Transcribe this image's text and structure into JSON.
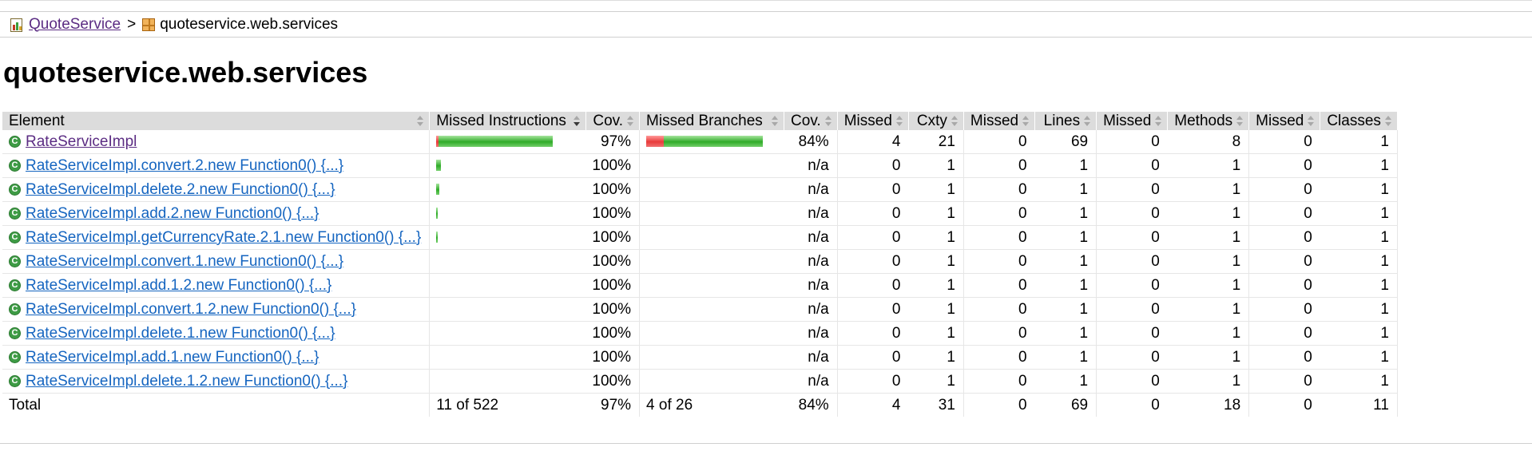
{
  "breadcrumb": {
    "root": "QuoteService",
    "separator": ">",
    "current": "quoteservice.web.services"
  },
  "page_title": "quoteservice.web.services",
  "table": {
    "headers": [
      "Element",
      "Missed Instructions",
      "Cov.",
      "Missed Branches",
      "Cov.",
      "Missed",
      "Cxty",
      "Missed",
      "Lines",
      "Missed",
      "Methods",
      "Missed",
      "Classes"
    ],
    "rows": [
      {
        "element": "RateServiceImpl",
        "visited": true,
        "instr_missed_frac": 0.02,
        "instr_bar_frac": 1.0,
        "instr_cov": "97%",
        "br_missed_frac": 0.15,
        "br_bar_frac": 1.0,
        "br_cov": "84%",
        "cx_missed": "4",
        "cxty": "21",
        "lines_missed": "0",
        "lines": "69",
        "meth_missed": "0",
        "methods": "8",
        "cls_missed": "0",
        "classes": "1"
      },
      {
        "element": "RateServiceImpl.convert.2.new Function0() {...}",
        "visited": false,
        "instr_missed_frac": 0,
        "instr_bar_frac": 0.04,
        "instr_cov": "100%",
        "br_missed_frac": null,
        "br_bar_frac": 0,
        "br_cov": "n/a",
        "cx_missed": "0",
        "cxty": "1",
        "lines_missed": "0",
        "lines": "1",
        "meth_missed": "0",
        "methods": "1",
        "cls_missed": "0",
        "classes": "1"
      },
      {
        "element": "RateServiceImpl.delete.2.new Function0() {...}",
        "visited": false,
        "instr_missed_frac": 0,
        "instr_bar_frac": 0.03,
        "instr_cov": "100%",
        "br_missed_frac": null,
        "br_bar_frac": 0,
        "br_cov": "n/a",
        "cx_missed": "0",
        "cxty": "1",
        "lines_missed": "0",
        "lines": "1",
        "meth_missed": "0",
        "methods": "1",
        "cls_missed": "0",
        "classes": "1"
      },
      {
        "element": "RateServiceImpl.add.2.new Function0() {...}",
        "visited": false,
        "instr_missed_frac": 0,
        "instr_bar_frac": 0.014,
        "instr_cov": "100%",
        "br_missed_frac": null,
        "br_bar_frac": 0,
        "br_cov": "n/a",
        "cx_missed": "0",
        "cxty": "1",
        "lines_missed": "0",
        "lines": "1",
        "meth_missed": "0",
        "methods": "1",
        "cls_missed": "0",
        "classes": "1"
      },
      {
        "element": "RateServiceImpl.getCurrencyRate.2.1.new Function0() {...}",
        "visited": false,
        "instr_missed_frac": 0,
        "instr_bar_frac": 0.014,
        "instr_cov": "100%",
        "br_missed_frac": null,
        "br_bar_frac": 0,
        "br_cov": "n/a",
        "cx_missed": "0",
        "cxty": "1",
        "lines_missed": "0",
        "lines": "1",
        "meth_missed": "0",
        "methods": "1",
        "cls_missed": "0",
        "classes": "1"
      },
      {
        "element": "RateServiceImpl.convert.1.new Function0() {...}",
        "visited": false,
        "instr_missed_frac": 0,
        "instr_bar_frac": 0,
        "instr_cov": "100%",
        "br_missed_frac": null,
        "br_bar_frac": 0,
        "br_cov": "n/a",
        "cx_missed": "0",
        "cxty": "1",
        "lines_missed": "0",
        "lines": "1",
        "meth_missed": "0",
        "methods": "1",
        "cls_missed": "0",
        "classes": "1"
      },
      {
        "element": "RateServiceImpl.add.1.2.new Function0() {...}",
        "visited": false,
        "instr_missed_frac": 0,
        "instr_bar_frac": 0,
        "instr_cov": "100%",
        "br_missed_frac": null,
        "br_bar_frac": 0,
        "br_cov": "n/a",
        "cx_missed": "0",
        "cxty": "1",
        "lines_missed": "0",
        "lines": "1",
        "meth_missed": "0",
        "methods": "1",
        "cls_missed": "0",
        "classes": "1"
      },
      {
        "element": "RateServiceImpl.convert.1.2.new Function0() {...}",
        "visited": false,
        "instr_missed_frac": 0,
        "instr_bar_frac": 0,
        "instr_cov": "100%",
        "br_missed_frac": null,
        "br_bar_frac": 0,
        "br_cov": "n/a",
        "cx_missed": "0",
        "cxty": "1",
        "lines_missed": "0",
        "lines": "1",
        "meth_missed": "0",
        "methods": "1",
        "cls_missed": "0",
        "classes": "1"
      },
      {
        "element": "RateServiceImpl.delete.1.new Function0() {...}",
        "visited": false,
        "instr_missed_frac": 0,
        "instr_bar_frac": 0,
        "instr_cov": "100%",
        "br_missed_frac": null,
        "br_bar_frac": 0,
        "br_cov": "n/a",
        "cx_missed": "0",
        "cxty": "1",
        "lines_missed": "0",
        "lines": "1",
        "meth_missed": "0",
        "methods": "1",
        "cls_missed": "0",
        "classes": "1"
      },
      {
        "element": "RateServiceImpl.add.1.new Function0() {...}",
        "visited": false,
        "instr_missed_frac": 0,
        "instr_bar_frac": 0,
        "instr_cov": "100%",
        "br_missed_frac": null,
        "br_bar_frac": 0,
        "br_cov": "n/a",
        "cx_missed": "0",
        "cxty": "1",
        "lines_missed": "0",
        "lines": "1",
        "meth_missed": "0",
        "methods": "1",
        "cls_missed": "0",
        "classes": "1"
      },
      {
        "element": "RateServiceImpl.delete.1.2.new Function0() {...}",
        "visited": false,
        "instr_missed_frac": 0,
        "instr_bar_frac": 0,
        "instr_cov": "100%",
        "br_missed_frac": null,
        "br_bar_frac": 0,
        "br_cov": "n/a",
        "cx_missed": "0",
        "cxty": "1",
        "lines_missed": "0",
        "lines": "1",
        "meth_missed": "0",
        "methods": "1",
        "cls_missed": "0",
        "classes": "1"
      }
    ],
    "total": {
      "label": "Total",
      "instr": "11 of 522",
      "instr_cov": "97%",
      "br": "4 of 26",
      "br_cov": "84%",
      "cx_missed": "4",
      "cxty": "31",
      "lines_missed": "0",
      "lines": "69",
      "meth_missed": "0",
      "methods": "18",
      "cls_missed": "0",
      "classes": "11"
    }
  },
  "colors": {
    "link": "#1565c0",
    "visited_link": "#5b2c83",
    "bar_green": "#2fab28",
    "bar_red": "#e83a3a",
    "header_bg": "#dcdcdc"
  },
  "icons": {
    "report": "report-icon",
    "package": "package-icon",
    "class": "class-icon",
    "sort": "sort-icon"
  }
}
